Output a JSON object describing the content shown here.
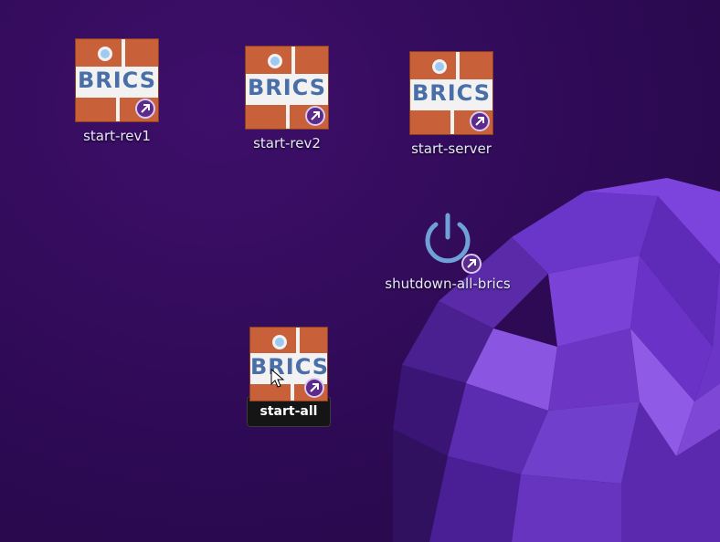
{
  "desktop": {
    "icons": [
      {
        "label": "start-rev1",
        "icon": "brics-logo-icon",
        "badge": "shortcut-arrow-icon"
      },
      {
        "label": "start-rev2",
        "icon": "brics-logo-icon",
        "badge": "shortcut-arrow-icon"
      },
      {
        "label": "start-server",
        "icon": "brics-logo-icon",
        "badge": "shortcut-arrow-icon"
      },
      {
        "label": "shutdown-all-brics",
        "icon": "power-icon",
        "badge": "shortcut-arrow-icon"
      },
      {
        "label": "start-all",
        "icon": "brics-logo-icon",
        "badge": "shortcut-arrow-icon",
        "hovered": true
      }
    ],
    "brand_text": "BRICS"
  },
  "colors": {
    "background": "#2e0a55",
    "tile": "#c8603a",
    "brand_text": "#4a6fa8",
    "power": "#6fa0d8"
  }
}
